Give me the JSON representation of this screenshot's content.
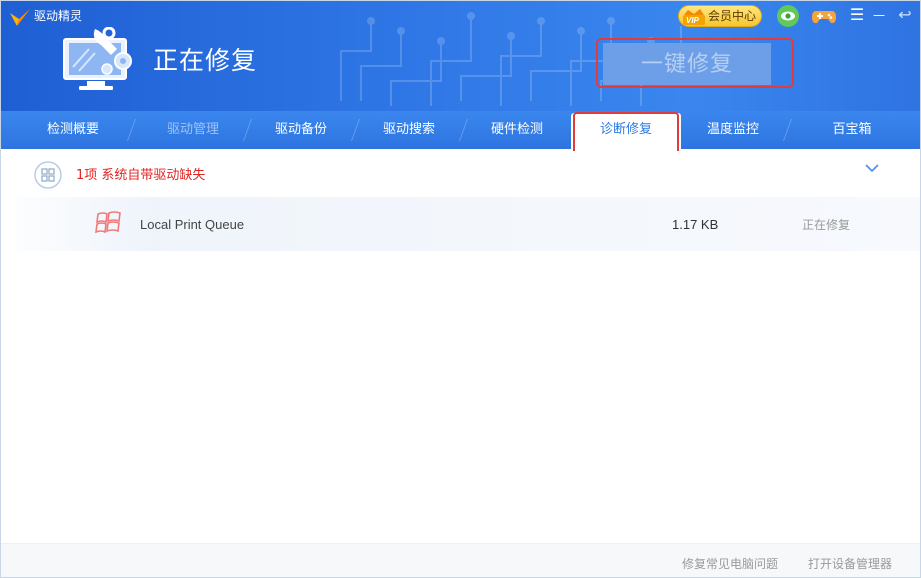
{
  "app": {
    "name": "驱动精灵"
  },
  "topbar": {
    "vip_badge_text": "VIP",
    "vip_label": "会员中心",
    "icons": [
      "eye-icon",
      "gamepad-icon",
      "menu-icon",
      "minimize-icon",
      "restore-icon"
    ],
    "menu_glyph": "☰",
    "minimize_glyph": "—",
    "restore_glyph": "↩"
  },
  "header": {
    "title": "正在修复",
    "action_button": "一键修复",
    "icon": "monitor-wrench-icon"
  },
  "tabs": [
    {
      "label": "检测概要",
      "state": "normal"
    },
    {
      "label": "驱动管理",
      "state": "dim"
    },
    {
      "label": "驱动备份",
      "state": "normal"
    },
    {
      "label": "驱动搜索",
      "state": "normal"
    },
    {
      "label": "硬件检测",
      "state": "normal"
    },
    {
      "label": "诊断修复",
      "state": "active"
    },
    {
      "label": "温度监控",
      "state": "normal"
    },
    {
      "label": "百宝箱",
      "state": "normal"
    }
  ],
  "group": {
    "label": "1项 系统自带驱动缺失",
    "icon": "windows-logo-icon"
  },
  "items": [
    {
      "name": "Local Print Queue",
      "size": "1.17 KB",
      "status": "正在修复",
      "icon": "windows-flag-icon"
    }
  ],
  "footer": {
    "link_fix": "修复常见电脑问题",
    "link_device_manager": "打开设备管理器"
  },
  "colors": {
    "header_blue": "#2f77e6",
    "active_tab_text": "#2a7ae2",
    "warning_red": "#e02424",
    "highlight_red": "#e23b3b"
  }
}
